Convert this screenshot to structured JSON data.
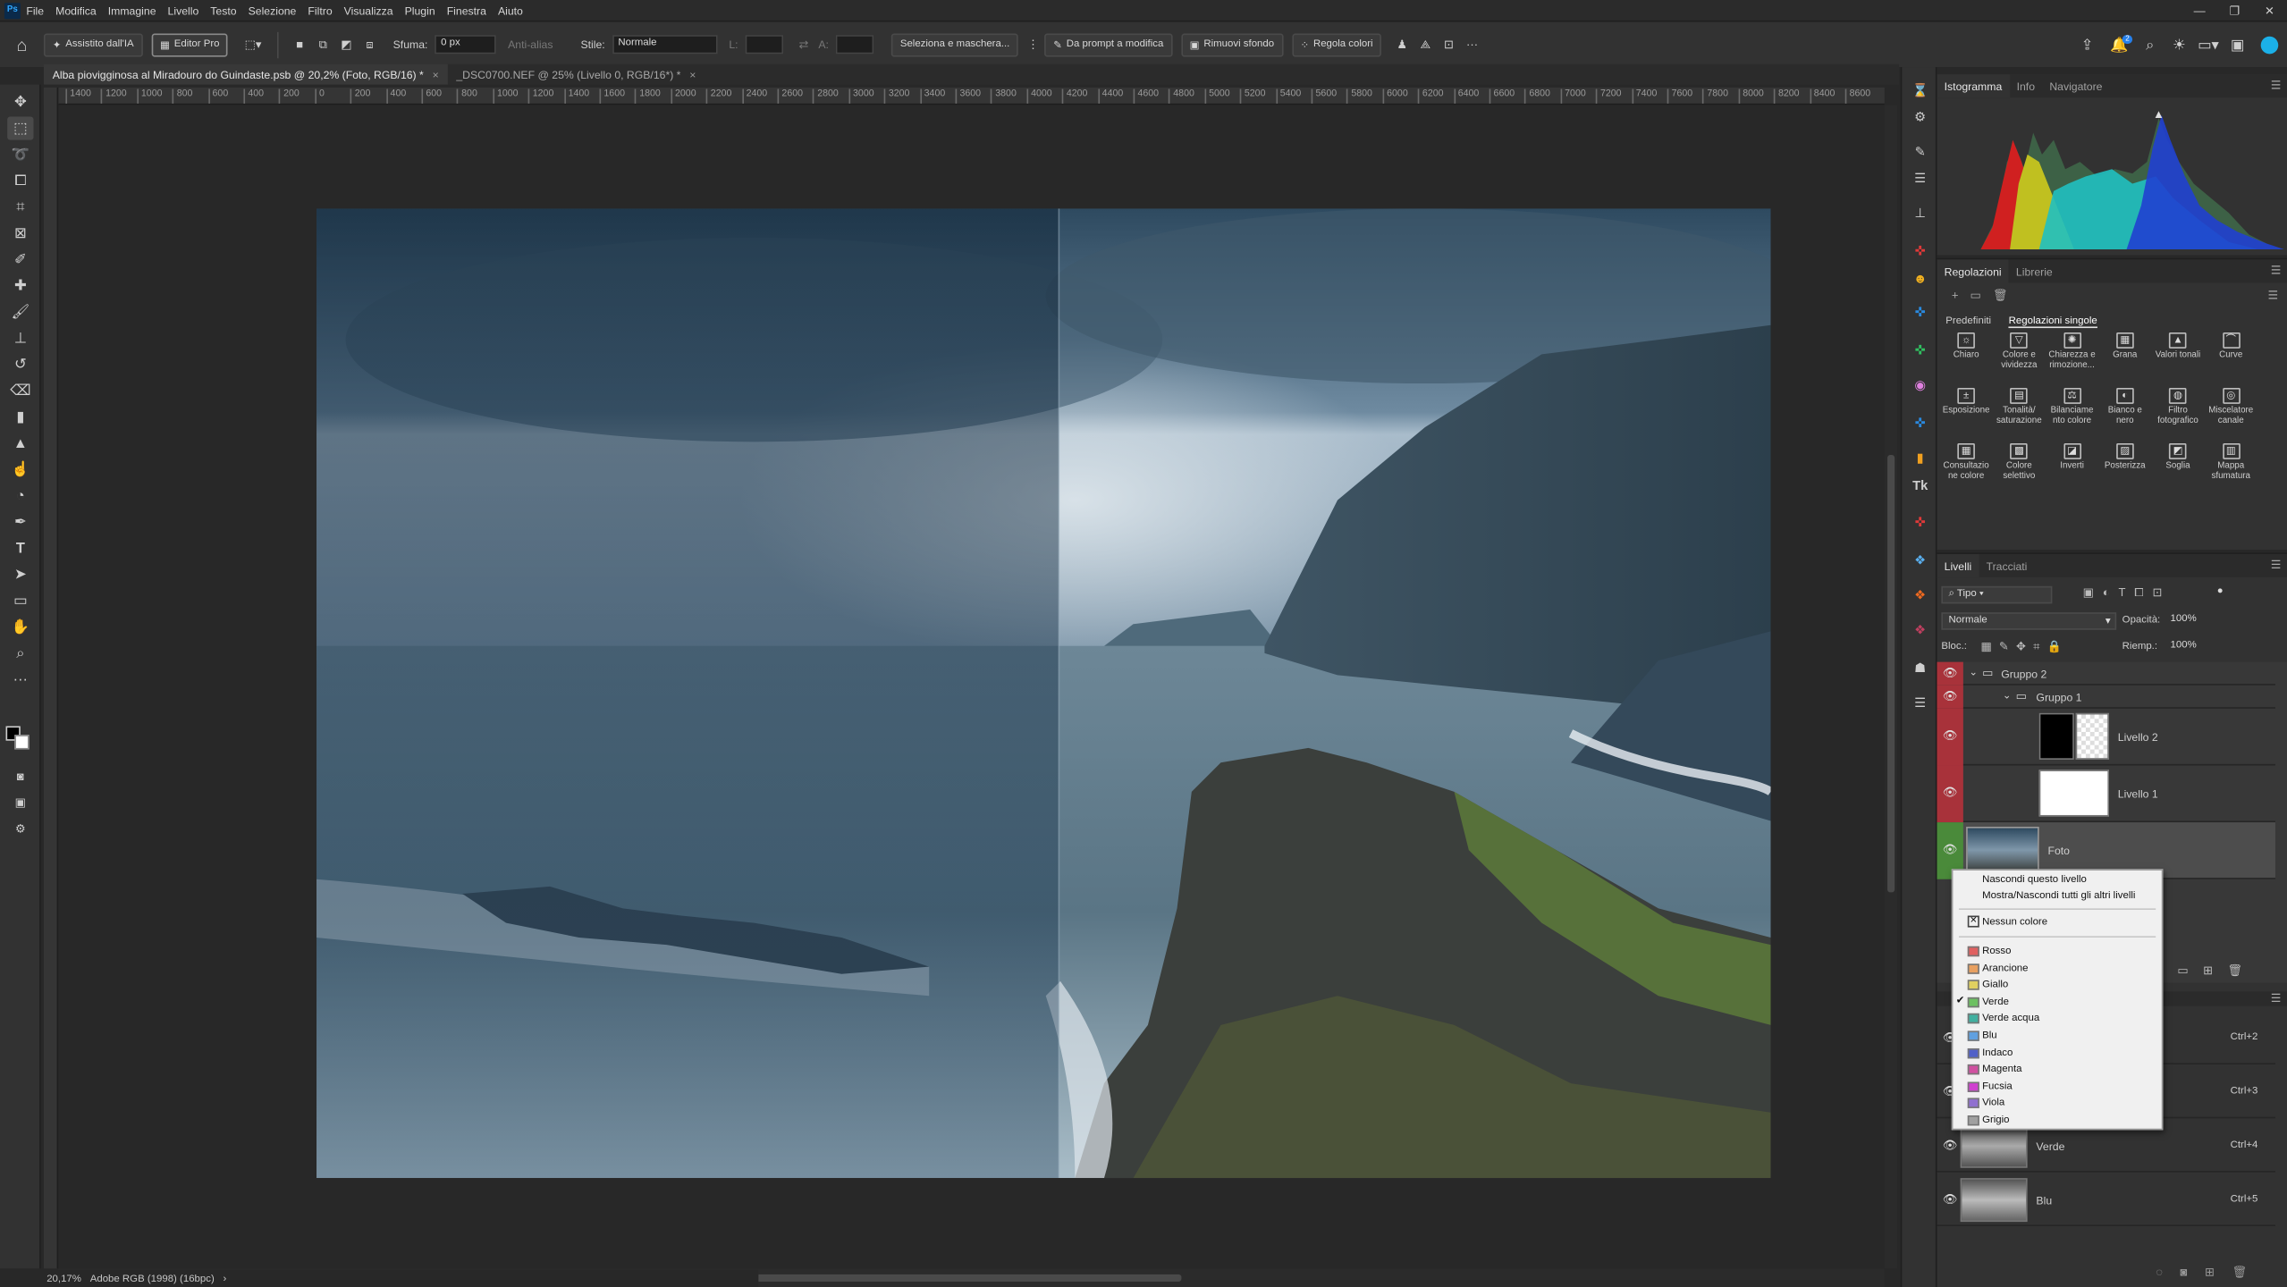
{
  "app": {
    "logo": "Ps"
  },
  "menubar": {
    "items": [
      "File",
      "Modifica",
      "Immagine",
      "Livello",
      "Testo",
      "Selezione",
      "Filtro",
      "Visualizza",
      "Plugin",
      "Finestra",
      "Aiuto"
    ]
  },
  "options": {
    "ai_assist": "Assistito dall'IA",
    "editor_pro": "Editor Pro",
    "feather_label": "Sfuma:",
    "feather_value": "0 px",
    "antialias_label": "Anti-alias",
    "style_label": "Stile:",
    "style_value": "Normale",
    "width_label": "L:",
    "height_label": "A:",
    "select_mask": "Seleziona e maschera...",
    "prompt_edit": "Da prompt a modifica",
    "remove_bg": "Rimuovi sfondo",
    "adjust_colors": "Regola colori",
    "notif_count": "2"
  },
  "tabs": [
    {
      "label": "Alba piovigginosa al Miradouro do Guindaste.psb @ 20,2% (Foto, RGB/16) *",
      "close": "×"
    },
    {
      "label": "_DSC0700.NEF @ 25% (Livello 0, RGB/16*) *",
      "close": "×"
    }
  ],
  "ruler": {
    "labels": [
      "1400",
      "1200",
      "1000",
      "800",
      "600",
      "400",
      "200",
      "0",
      "200",
      "400",
      "600",
      "800",
      "1000",
      "1200",
      "1400",
      "1600",
      "1800",
      "2000",
      "2200",
      "2400",
      "2600",
      "2800",
      "3000",
      "3200",
      "3400",
      "3600",
      "3800",
      "4000",
      "4200",
      "4400",
      "4600",
      "4800",
      "5000",
      "5200",
      "5400",
      "5600",
      "5800",
      "6000",
      "6200",
      "6400",
      "6600",
      "6800",
      "7000",
      "7200",
      "7400",
      "7600",
      "7800",
      "8000",
      "8200",
      "8400",
      "8600"
    ]
  },
  "status": {
    "zoom": "20,17%",
    "profile": "Adobe RGB (1998) (16bpc)",
    "arrow": "›"
  },
  "histogram_panel": {
    "tabs": [
      "Istogramma",
      "Info",
      "Navigatore"
    ],
    "warning": "▲"
  },
  "adjustments_panel": {
    "tabs": [
      "Regolazioni",
      "Librerie"
    ],
    "subtabs": [
      "Predefiniti",
      "Regolazioni singole"
    ],
    "items": [
      [
        "Chiaro"
      ],
      [
        "Colore e",
        "vividezza"
      ],
      [
        "Chiarezza e",
        "rimozione..."
      ],
      [
        "Grana"
      ],
      [
        "Valori tonali"
      ],
      [
        "Curve"
      ],
      [
        "Esposizione"
      ],
      [
        "Tonalità/",
        "saturazione"
      ],
      [
        "Bilanciame",
        "nto colore"
      ],
      [
        "Bianco e",
        "nero"
      ],
      [
        "Filtro",
        "fotografico"
      ],
      [
        "Miscelatore",
        "canale"
      ],
      [
        "Consultazio",
        "ne colore"
      ],
      [
        "Colore",
        "selettivo"
      ],
      [
        "Inverti"
      ],
      [
        "Posterizza"
      ],
      [
        "Soglia"
      ],
      [
        "Mappa",
        "sfumatura"
      ]
    ],
    "icons": [
      "☼",
      "▽",
      "✺",
      "▦",
      "▲",
      "⌒",
      "±",
      "▤",
      "⚖",
      "◐",
      "◍",
      "◎",
      "▦",
      "▩",
      "◪",
      "▨",
      "◩",
      "▥"
    ]
  },
  "layers_panel": {
    "tabs": [
      "Livelli",
      "Tracciati"
    ],
    "filter": "Tipo",
    "blend_mode": "Normale",
    "opacity_label": "Opacità:",
    "opacity_value": "100%",
    "lock_label": "Bloc.:",
    "fill_label": "Riemp.:",
    "fill_value": "100%",
    "layers": [
      {
        "name": "Gruppo 2",
        "type": "group",
        "color": "#a8323a"
      },
      {
        "name": "Gruppo 1",
        "type": "group",
        "color": "#a8323a"
      },
      {
        "name": "Livello 2",
        "type": "layer",
        "color": "#a8323a"
      },
      {
        "name": "Livello 1",
        "type": "layer",
        "color": "#a8323a"
      },
      {
        "name": "Foto",
        "type": "photo",
        "color": "#4a8a3a"
      }
    ]
  },
  "channels": [
    {
      "name": "",
      "shortcut": "Ctrl+2"
    },
    {
      "name": "",
      "shortcut": "Ctrl+3"
    },
    {
      "name": "Verde",
      "shortcut": "Ctrl+4"
    },
    {
      "name": "Blu",
      "shortcut": "Ctrl+5"
    }
  ],
  "context_menu": {
    "hide_layer": "Nascondi questo livello",
    "toggle_others": "Mostra/Nascondi tutti gli altri livelli",
    "no_color": "Nessun colore",
    "checked": "Verde",
    "colors": [
      {
        "name": "Rosso",
        "hex": "#e06060"
      },
      {
        "name": "Arancione",
        "hex": "#e8a060"
      },
      {
        "name": "Giallo",
        "hex": "#e0d060"
      },
      {
        "name": "Verde",
        "hex": "#6cc060"
      },
      {
        "name": "Verde acqua",
        "hex": "#40b0a0"
      },
      {
        "name": "Blu",
        "hex": "#60a0e0"
      },
      {
        "name": "Indaco",
        "hex": "#5060c8"
      },
      {
        "name": "Magenta",
        "hex": "#d050a0"
      },
      {
        "name": "Fucsia",
        "hex": "#d040d0"
      },
      {
        "name": "Viola",
        "hex": "#9070d0"
      },
      {
        "name": "Grigio",
        "hex": "#a0a0a0"
      }
    ]
  }
}
